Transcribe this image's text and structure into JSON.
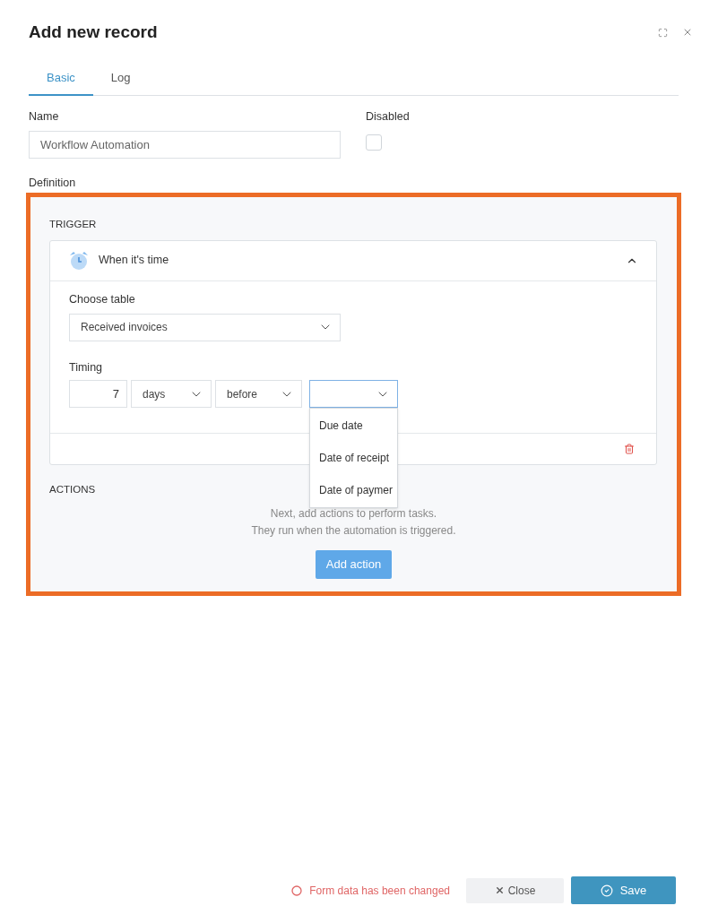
{
  "dialog": {
    "title": "Add new record"
  },
  "tabs": [
    {
      "label": "Basic",
      "selected": true
    },
    {
      "label": "Log",
      "selected": false
    }
  ],
  "name_field": {
    "label": "Name",
    "value": "Workflow Automation"
  },
  "disabled_field": {
    "label": "Disabled",
    "checked": false
  },
  "definition": {
    "label": "Definition",
    "trigger": {
      "heading": "TRIGGER",
      "card_title": "When it's time",
      "expanded": true,
      "table_label": "Choose table",
      "table_value": "Received invoices",
      "timing_label": "Timing",
      "amount": "7",
      "unit": "days",
      "relation": "before",
      "date_field": {
        "open": true,
        "options": [
          "Due date",
          "Date of receipt",
          "Date of paymer"
        ]
      }
    },
    "actions": {
      "heading": "ACTIONS",
      "hint": [
        "Next, add actions to perform tasks.",
        "They run when the automation is triggered."
      ],
      "add_button": "Add action"
    }
  },
  "footer": {
    "status": "Form data has been changed",
    "close": "Close",
    "save": "Save"
  }
}
